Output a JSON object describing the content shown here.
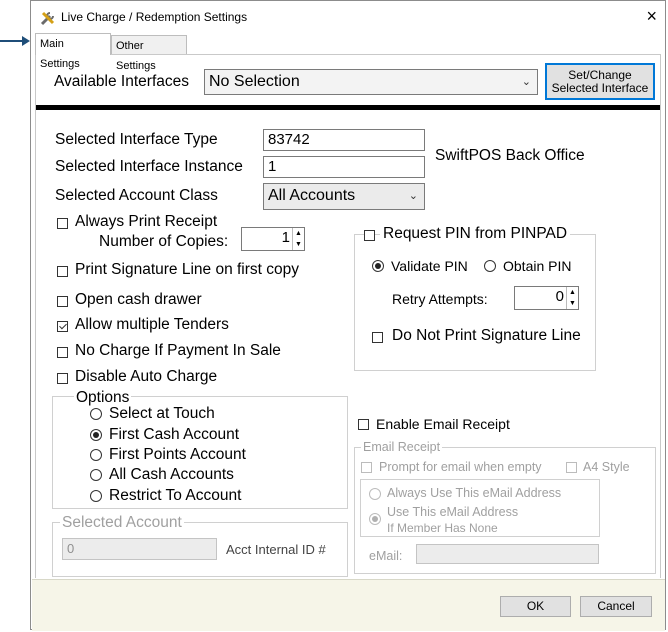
{
  "window": {
    "title": "Live Charge / Redemption Settings",
    "close": "×"
  },
  "tabs": [
    "Main Settings",
    "Other Settings"
  ],
  "interfaces": {
    "label": "Available Interfaces",
    "value": "No Selection",
    "set_button": "Set/Change\nSelected Interface"
  },
  "fields": {
    "type_label": "Selected Interface Type",
    "type_value": "83742",
    "instance_label": "Selected Interface Instance",
    "instance_value": "1",
    "backoffice": "SwiftPOS Back Office",
    "class_label": "Selected Account Class",
    "class_value": "All Accounts"
  },
  "checks": {
    "always_print": "Always Print Receipt",
    "copies_label": "Number of Copies:",
    "copies_value": "1",
    "sig_line": "Print Signature Line on first copy",
    "cash_drawer": "Open cash drawer",
    "multi_tenders": "Allow multiple Tenders",
    "no_charge": "No Charge If Payment In Sale",
    "disable_auto": "Disable Auto Charge"
  },
  "options": {
    "title": "Options",
    "items": [
      "Select at Touch",
      "First Cash Account",
      "First Points Account",
      "All Cash Accounts",
      "Restrict To Account"
    ],
    "selected": 1
  },
  "selected_account": {
    "title": "Selected Account",
    "value": "0",
    "internal_id": "Acct Internal ID  #"
  },
  "pin": {
    "request": "Request PIN from PINPAD",
    "validate": "Validate PIN",
    "obtain": "Obtain PIN",
    "retry_label": "Retry Attempts:",
    "retry_value": "0",
    "no_sig": "Do Not Print Signature Line"
  },
  "email": {
    "enable": "Enable Email Receipt",
    "group": "Email Receipt",
    "prompt": "Prompt for email when empty",
    "a4": "A4 Style",
    "always_use": "Always Use This eMail Address",
    "use_line1": "Use This eMail Address",
    "use_line2": "If Member Has None",
    "email_label": "eMail:"
  },
  "footer": {
    "ok": "OK",
    "cancel": "Cancel"
  },
  "colors": {
    "arrow": "#1f4e79",
    "focus_border": "#0078d7",
    "footer_bg": "#f6f5e8"
  }
}
